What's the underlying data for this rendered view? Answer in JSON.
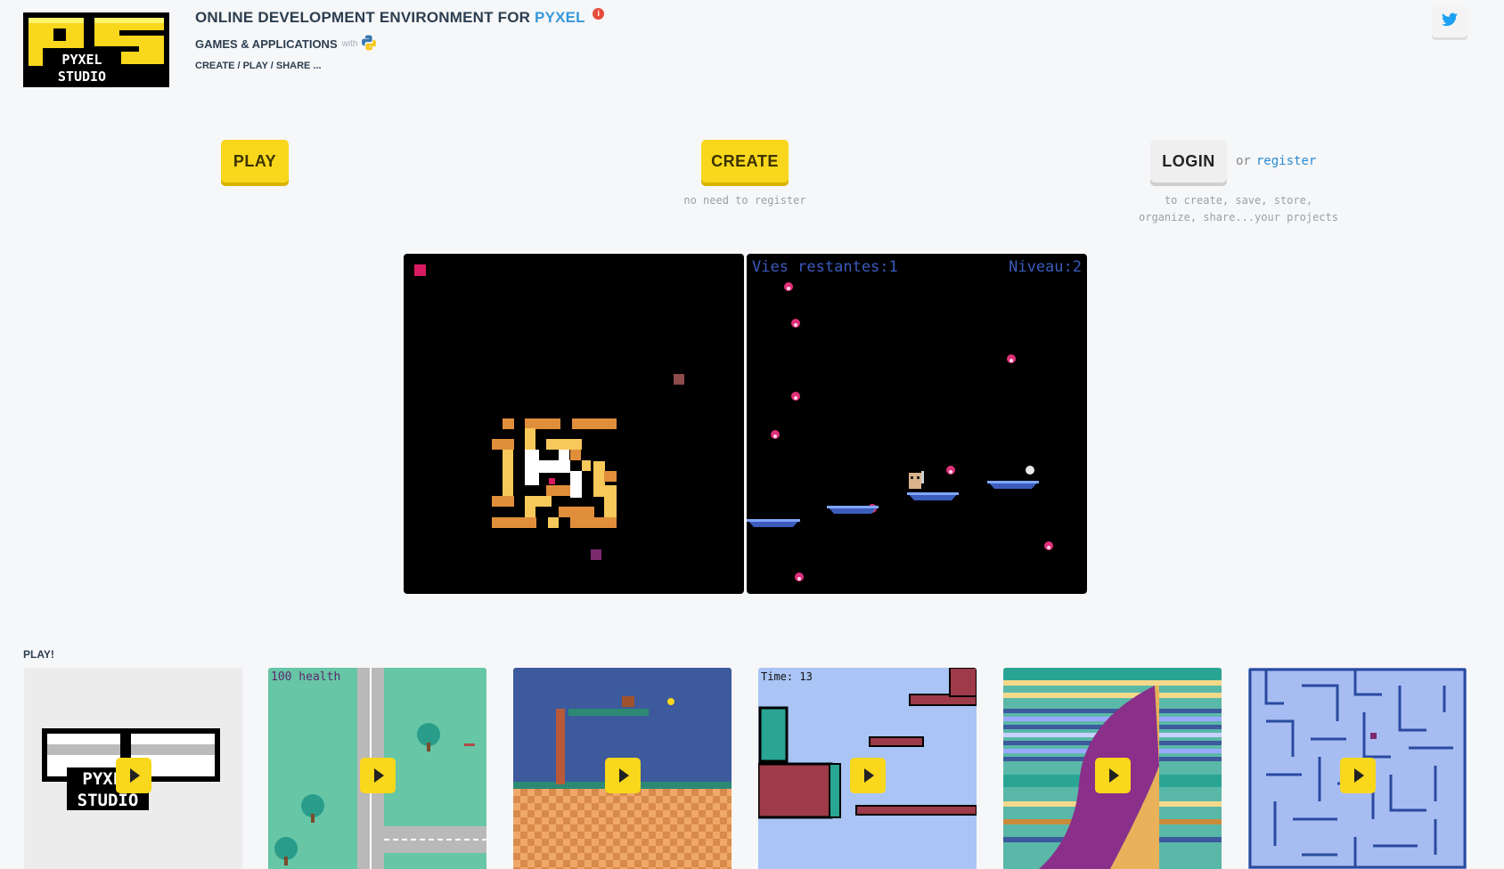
{
  "header": {
    "logo_text_top": "PS",
    "logo_text_mid": "PYXEL",
    "logo_text_bot": "STUDIO",
    "title_prefix": "ONLINE DEVELOPMENT ENVIRONMENT FOR",
    "title_highlight": "PYXEL",
    "badge": "i",
    "subtitle": "GAMES & APPLICATIONS",
    "with_label": "with",
    "slogan": "CREATE / PLAY / SHARE ...",
    "twitter_icon": "twitter-icon"
  },
  "actions": {
    "play_label": "PLAY",
    "create_label": "CREATE",
    "create_note": "no need to register",
    "login_label": "LOGIN",
    "or_label": "or",
    "register_label": "register",
    "login_note_1": "to create, save, store,",
    "login_note_2": "organize, share...your projects"
  },
  "demos": {
    "right_hud_left": "Vies restantes:1",
    "right_hud_right": "Niveau:2"
  },
  "play_section": {
    "title": "PLAY!",
    "games": [
      {
        "name": "pyxel-studio-logo"
      },
      {
        "name": "top-down-city",
        "hud": "100 health"
      },
      {
        "name": "platformer-checker"
      },
      {
        "name": "platformer-sky",
        "hud": "Time: 13"
      },
      {
        "name": "tunnel-stripes"
      },
      {
        "name": "blue-maze"
      }
    ]
  },
  "colors": {
    "accent_yellow": "#f9d71c",
    "link_blue": "#3498db",
    "background": "#f6f7f9"
  }
}
